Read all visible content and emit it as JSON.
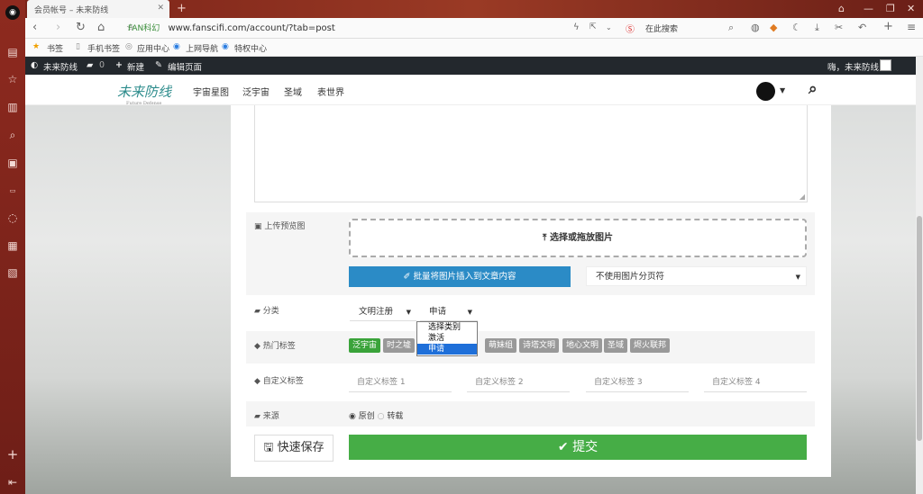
{
  "browser": {
    "tab_title": "会员帐号 – 未来防线",
    "site_badge": "FAN科幻",
    "url": "www.fanscifi.com/account/?tab=post",
    "search_placeholder": "在此搜索",
    "bookmarks": [
      "书签",
      "手机书签",
      "应用中心",
      "上网导航",
      "特权中心"
    ]
  },
  "wp_bar": {
    "site_name": "未来防线",
    "comments_count": "0",
    "new_label": "新建",
    "edit_label": "编辑页面",
    "greeting": "嗨，未来防线"
  },
  "header": {
    "logo_text": "未来防线",
    "logo_sub": "Future Defense",
    "nav": [
      "宇宙星图",
      "泛宇宙",
      "圣域",
      "表世界"
    ]
  },
  "form": {
    "upload_label": "上传预览图",
    "dropzone_label": "选择或拖放图片",
    "insert_button": "批量将图片插入到文章内容",
    "pagination_select": "不使用图片分页符",
    "category_label": "分类",
    "category_primary": "文明注册",
    "category_secondary": "申请",
    "category_options": [
      "选择类别",
      "激活",
      "申请"
    ],
    "category_selected_index": 2,
    "hot_tags_label": "热门标签",
    "hot_tags": [
      "泛宇宙",
      "时之墟",
      "萌妹组",
      "诗塔文明",
      "地心文明",
      "圣域",
      "烬火联邦"
    ],
    "custom_tags_label": "自定义标签",
    "custom_tag_placeholders": [
      "自定义标签 1",
      "自定义标签 2",
      "自定义标签 3",
      "自定义标签 4"
    ],
    "source_label": "来源",
    "source_original": "原创",
    "source_repost": "转载",
    "quick_save": "快速保存",
    "submit": "提交"
  },
  "colors": {
    "accent_blue": "#2b8bc6",
    "submit_green": "#46ad46",
    "tag_active": "#3aa33a",
    "tag_default": "#999999"
  }
}
